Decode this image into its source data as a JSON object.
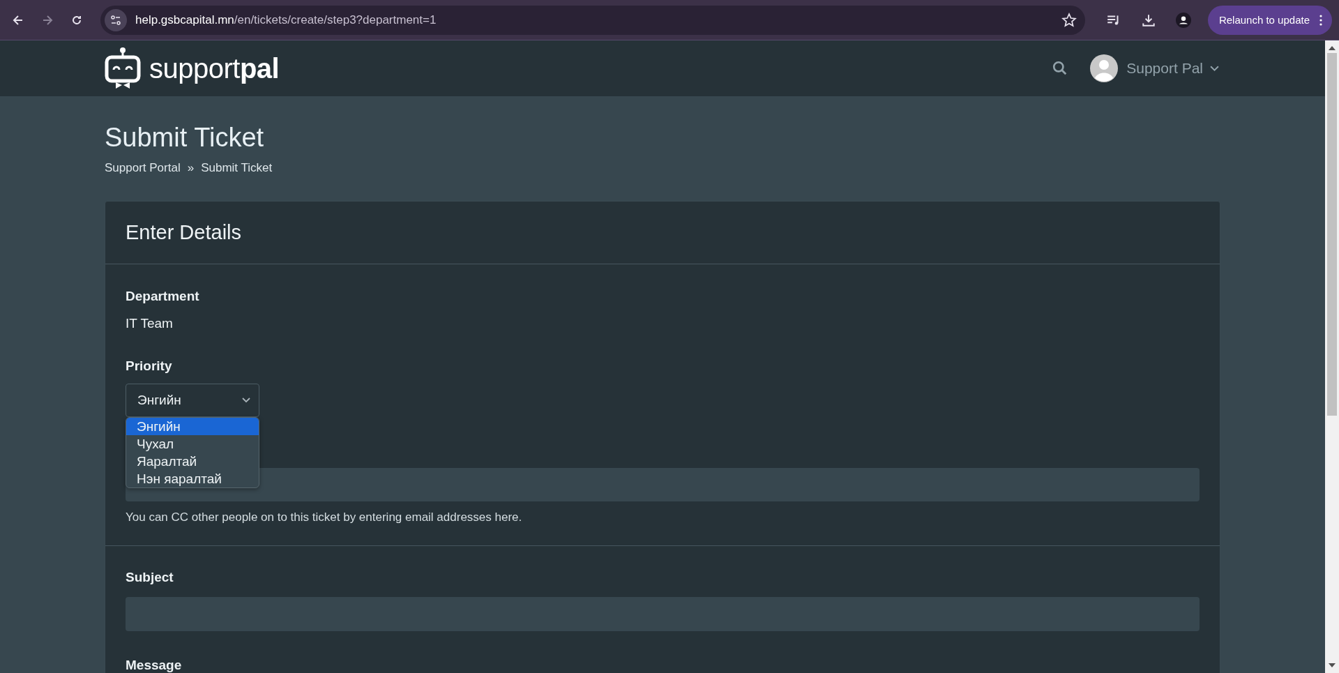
{
  "browser": {
    "url_host": "help.gsbcapital.mn",
    "url_path": "/en/tickets/create/step3?department=1",
    "relaunch_label": "Relaunch to update"
  },
  "header": {
    "logo_light": "support",
    "logo_bold": "pal",
    "user_name": "Support Pal"
  },
  "page": {
    "title": "Submit Ticket",
    "breadcrumbs": [
      "Support Portal",
      "Submit Ticket"
    ],
    "breadcrumb_separator": "»"
  },
  "card": {
    "title": "Enter Details",
    "department": {
      "label": "Department",
      "value": "IT Team"
    },
    "priority": {
      "label": "Priority",
      "value": "Энгийн",
      "expanded": true,
      "options": [
        {
          "label": "Энгийн",
          "selected": true
        },
        {
          "label": "Чухал",
          "selected": false
        },
        {
          "label": "Яаралтай",
          "selected": false
        },
        {
          "label": "Нэн яаралтай",
          "selected": false
        }
      ]
    },
    "cc": {
      "help": "You can CC other people on to this ticket by entering email addresses here."
    },
    "subject": {
      "label": "Subject"
    },
    "message": {
      "label": "Message"
    }
  }
}
